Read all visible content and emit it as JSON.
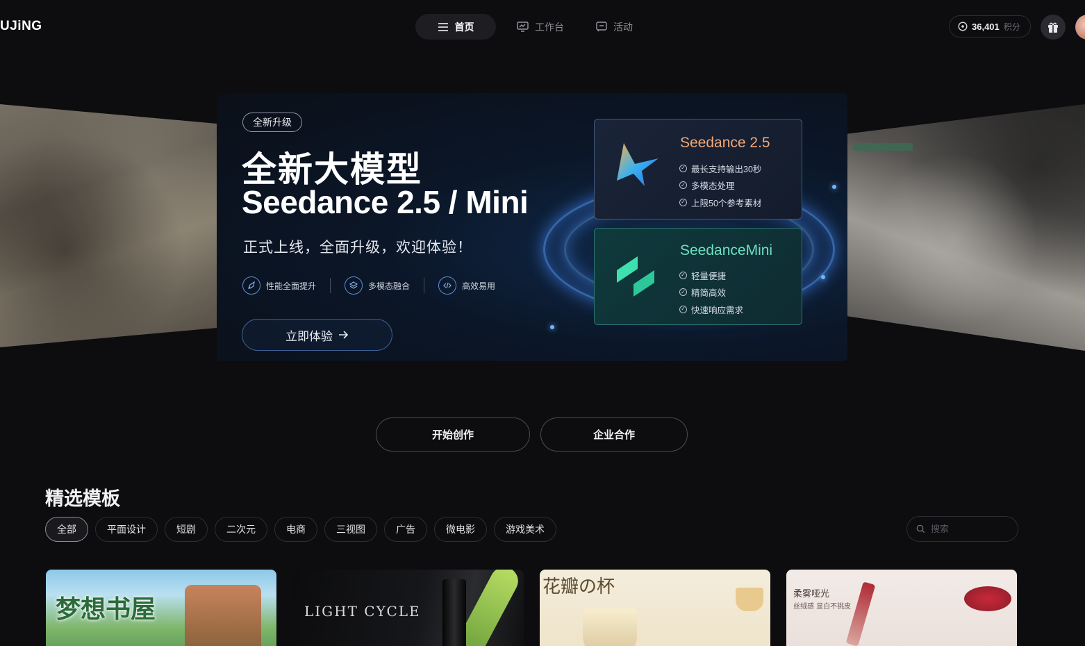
{
  "header": {
    "logo": "UJiNG",
    "nav": [
      {
        "label": "首页",
        "icon": "menu-icon",
        "active": true
      },
      {
        "label": "工作台",
        "icon": "dashboard-icon",
        "active": false
      },
      {
        "label": "活动",
        "icon": "activity-icon",
        "active": false
      }
    ],
    "points": {
      "value": "36,401",
      "unit": "积分"
    },
    "gift_icon": "gift-icon",
    "avatar": "user-avatar"
  },
  "hero": {
    "badge": "全新升级",
    "title": "全新大模型",
    "subtitle": "Seedance 2.5 / Mini",
    "description": "正式上线，全面升级，欢迎体验！",
    "features": [
      {
        "label": "性能全面提升",
        "icon": "rocket-icon"
      },
      {
        "label": "多模态融合",
        "icon": "layers-icon"
      },
      {
        "label": "高效易用",
        "icon": "code-icon"
      }
    ],
    "cta": "立即体验",
    "cta_icon": "arrow-right-icon",
    "cards": [
      {
        "title": "Seedance 2.5",
        "items": [
          "最长支持输出30秒",
          "多模态处理",
          "上限50个参考素材"
        ],
        "accent": "#f2a878"
      },
      {
        "title": "SeedanceMini",
        "items": [
          "轻量便捷",
          "精简高效",
          "快速响应需求"
        ],
        "accent": "#6fe0c3"
      }
    ]
  },
  "actions": {
    "start": "开始创作",
    "business": "企业合作"
  },
  "templates": {
    "section_title": "精选模板",
    "filters": [
      "全部",
      "平面设计",
      "短剧",
      "二次元",
      "电商",
      "三视图",
      "广告",
      "微电影",
      "游戏美术"
    ],
    "active_filter": "全部",
    "search_placeholder": "搜索",
    "cards": [
      {
        "title": "梦想书屋"
      },
      {
        "title": "LIGHT CYCLE"
      },
      {
        "title": "花瓣の杯"
      },
      {
        "title": "柔雾哑光",
        "subtitle": "丝绒感 显白不挑皮"
      }
    ]
  }
}
